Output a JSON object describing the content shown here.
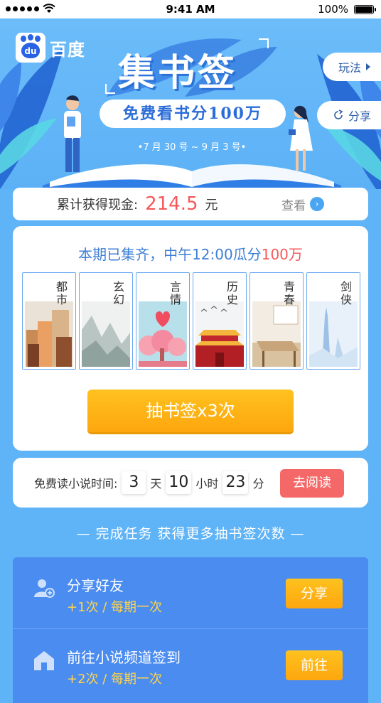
{
  "status_bar": {
    "time": "9:41 AM",
    "battery": "100%"
  },
  "brand": {
    "logo_text": "百度",
    "logo_mark": "du"
  },
  "hero": {
    "title": "集书签",
    "subtitle": "免费看书分100万",
    "dates": "•7 月 30 号 ~ 9 月 3 号•"
  },
  "side_buttons": {
    "rules": "玩法",
    "share": "分享"
  },
  "cash": {
    "label": "累计获得现金:",
    "amount": "214.5",
    "unit": "元",
    "view": "查看"
  },
  "books": {
    "headline_prefix": "本期已集齐，中午12:00瓜分",
    "headline_highlight": "100万",
    "bookmarks": [
      {
        "name": "都市",
        "theme": "city"
      },
      {
        "name": "玄幻",
        "theme": "fantasy"
      },
      {
        "name": "言情",
        "theme": "romance"
      },
      {
        "name": "历史",
        "theme": "history"
      },
      {
        "name": "青春",
        "theme": "youth"
      },
      {
        "name": "剑侠",
        "theme": "swordsman"
      }
    ],
    "draw_button": "抽书签x3次"
  },
  "timer": {
    "label": "免费读小说时间:",
    "days": "3",
    "days_unit": "天",
    "hours": "10",
    "hours_unit": "小时",
    "minutes": "23",
    "minutes_unit": "分",
    "button": "去阅读"
  },
  "section_title": "— 完成任务 获得更多抽书签次数 —",
  "tasks": [
    {
      "title": "分享好友",
      "reward": "+1次 / 每期一次",
      "button": "分享",
      "icon": "add-user-icon"
    },
    {
      "title": "前往小说频道签到",
      "reward": "+2次 / 每期一次",
      "button": "前往",
      "icon": "home-icon"
    }
  ],
  "colors": {
    "primary_blue": "#5fb3f7",
    "accent_red": "#f5585a",
    "orange": "#fda60d",
    "task_blue": "#4b8cf0"
  }
}
